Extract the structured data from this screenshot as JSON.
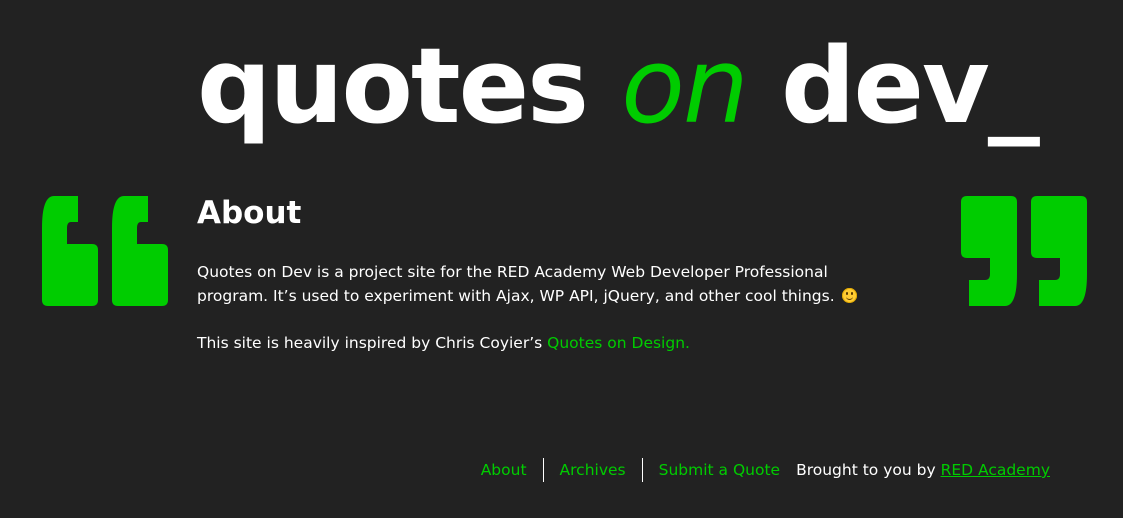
{
  "colors": {
    "background": "#222222",
    "accent": "#00cc00",
    "text": "#ffffff"
  },
  "header": {
    "logo_part1": "quotes ",
    "logo_part2": "on",
    "logo_part3": " dev_"
  },
  "icons": {
    "left_quote": "open-quote-icon",
    "right_quote": "close-quote-icon",
    "emoji": "smiley-icon"
  },
  "main": {
    "title": "About",
    "paragraph1": "Quotes on Dev is a project site for the RED Academy Web Developer Professional program. It’s used to experiment with Ajax, WP API, jQuery, and other cool things.",
    "paragraph2_prefix": "This site is heavily inspired by Chris Coyier’s ",
    "paragraph2_link": "Quotes on Design."
  },
  "footer": {
    "nav": [
      {
        "label": "About"
      },
      {
        "label": "Archives"
      },
      {
        "label": "Submit a Quote"
      }
    ],
    "credit_prefix": "Brought to you by ",
    "credit_link": "RED Academy"
  }
}
